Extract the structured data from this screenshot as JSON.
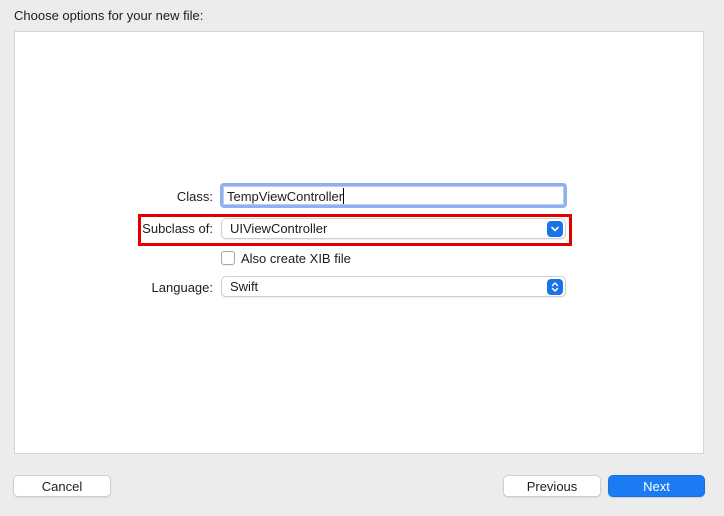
{
  "header": {
    "title": "Choose options for your new file:"
  },
  "form": {
    "class_label": "Class:",
    "class_value": "TempViewController",
    "subclass_label": "Subclass of:",
    "subclass_value": "UIViewController",
    "xib_label": "Also create XIB file",
    "xib_checked": false,
    "language_label": "Language:",
    "language_value": "Swift"
  },
  "footer": {
    "cancel_label": "Cancel",
    "previous_label": "Previous",
    "next_label": "Next"
  },
  "colors": {
    "accent": "#1a7bf2",
    "highlight": "#e10000",
    "focus_ring": "#8fb2ec"
  },
  "icons": {
    "subclass_popup": "chevron-down-icon",
    "language_popup": "up-down-chevron-icon"
  }
}
